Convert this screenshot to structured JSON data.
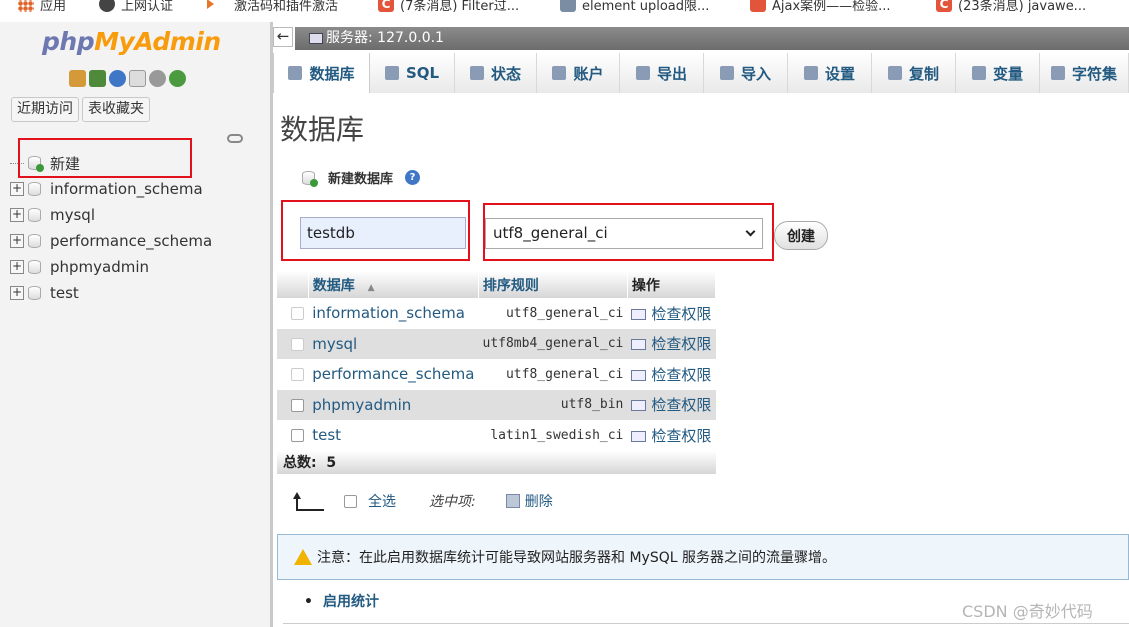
{
  "bookmarks": [
    {
      "label": "应用",
      "icon": "apps-grid-icon"
    },
    {
      "label": "上网认证",
      "icon": "globe-icon"
    },
    {
      "label": "激活码和插件激活",
      "icon": "arrow-icon"
    },
    {
      "label": "(7条消息) Filter过...",
      "icon": "csdn-icon"
    },
    {
      "label": "element upload限...",
      "icon": "avatar-icon"
    },
    {
      "label": "Ajax案例——检验...",
      "icon": "box-icon"
    },
    {
      "label": "(23条消息) javawe...",
      "icon": "csdn-icon"
    }
  ],
  "nav": {
    "logo_part1": "php",
    "logo_part2": "MyAdmin",
    "tabs": [
      "近期访问",
      "表收藏夹"
    ],
    "tree": [
      {
        "label": "新建",
        "is_new": true
      },
      {
        "label": "information_schema"
      },
      {
        "label": "mysql"
      },
      {
        "label": "performance_schema"
      },
      {
        "label": "phpmyadmin"
      },
      {
        "label": "test"
      }
    ]
  },
  "header": {
    "back": "←",
    "server": "服务器: 127.0.0.1"
  },
  "menu": [
    {
      "label": "数据库",
      "icon": "database-icon",
      "active": true
    },
    {
      "label": "SQL",
      "icon": "sql-icon"
    },
    {
      "label": "状态",
      "icon": "status-icon"
    },
    {
      "label": "账户",
      "icon": "accounts-icon"
    },
    {
      "label": "导出",
      "icon": "export-icon"
    },
    {
      "label": "导入",
      "icon": "import-icon"
    },
    {
      "label": "设置",
      "icon": "wrench-icon"
    },
    {
      "label": "复制",
      "icon": "replication-icon"
    },
    {
      "label": "变量",
      "icon": "variables-icon"
    },
    {
      "label": "字符集",
      "icon": "charset-icon"
    }
  ],
  "main": {
    "title": "数据库",
    "create_label": "新建数据库",
    "db_name_value": "testdb",
    "collation_value": "utf8_general_ci",
    "create_button": "创建",
    "table": {
      "headers": [
        "数据库",
        "排序规则",
        "操作"
      ],
      "rows": [
        {
          "name": "information_schema",
          "collation": "utf8_general_ci",
          "action": "检查权限"
        },
        {
          "name": "mysql",
          "collation": "utf8mb4_general_ci",
          "action": "检查权限"
        },
        {
          "name": "performance_schema",
          "collation": "utf8_general_ci",
          "action": "检查权限"
        },
        {
          "name": "phpmyadmin",
          "collation": "utf8_bin",
          "action": "检查权限"
        },
        {
          "name": "test",
          "collation": "latin1_swedish_ci",
          "action": "检查权限"
        }
      ],
      "total_label": "总数:",
      "total_value": "5"
    },
    "select_all": "全选",
    "with_selected": "选中项:",
    "delete": "删除",
    "notice": "注意：在此启用数据库统计可能导致网站服务器和 MySQL 服务器之间的流量骤增。",
    "enable_stats": "启用统计"
  },
  "watermark": "CSDN @奇妙代码"
}
